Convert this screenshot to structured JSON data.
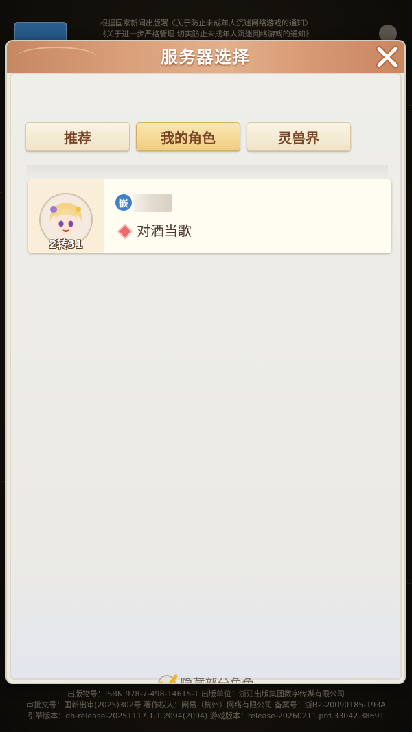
{
  "background": {
    "notice_lines": [
      "根据国家新闻出版署《关于防止未成年人沉迷网络游戏的通知》",
      "《关于进一步严格管理 切实防止未成年人沉迷网络游戏的通知》"
    ],
    "footer_lines": [
      "出版物号：ISBN 978-7-498-14615-1    出版单位：浙江出版集团数字传媒有限公司",
      "审批文号：国新出审(2025)302号    著作权人：网易（杭州）网络有限公司    备案号：浙B2-20090185-193A",
      "引擎版本：dh-release-20251117.1.1.2094(2094)    游戏版本：release-20260211.prd.33042.38691"
    ]
  },
  "dialog": {
    "title": "服务器选择",
    "tabs": [
      {
        "label": "推荐",
        "active": false
      },
      {
        "label": "我的角色",
        "active": true
      },
      {
        "label": "灵兽界",
        "active": false
      }
    ],
    "roles": [
      {
        "server_icon_char": "嵌",
        "level_badge": "2转31",
        "role_name": "对酒当歌"
      }
    ],
    "hide_roles": {
      "label": "隐藏部分角色",
      "checked": true
    }
  },
  "colors": {
    "header": "#d9a07a",
    "active_tab": "#f0cd82",
    "server_icon": "#3e7fc6",
    "diamond": "#ef6a6a",
    "check": "#f0b429"
  }
}
